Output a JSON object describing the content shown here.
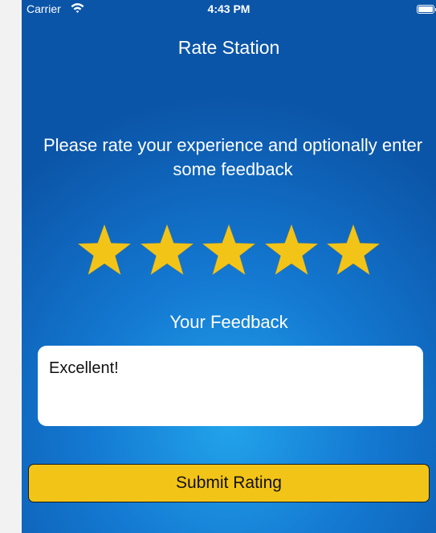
{
  "status_bar": {
    "carrier": "Carrier",
    "time": "4:43 PM",
    "icons": [
      "wifi-icon",
      "battery-icon"
    ]
  },
  "nav": {
    "title": "Rate Station"
  },
  "prompt": "Please rate your experience and optionally enter some feedback",
  "rating": {
    "value": 5,
    "max": 5,
    "star_color": "#f3c418"
  },
  "feedback": {
    "label": "Your Feedback",
    "value": "Excellent!"
  },
  "submit": {
    "label": "Submit Rating",
    "color": "#f3c418"
  },
  "colors": {
    "background_center": "#22a3ea",
    "background_edge": "#0b55a8",
    "text": "#ffffff"
  }
}
